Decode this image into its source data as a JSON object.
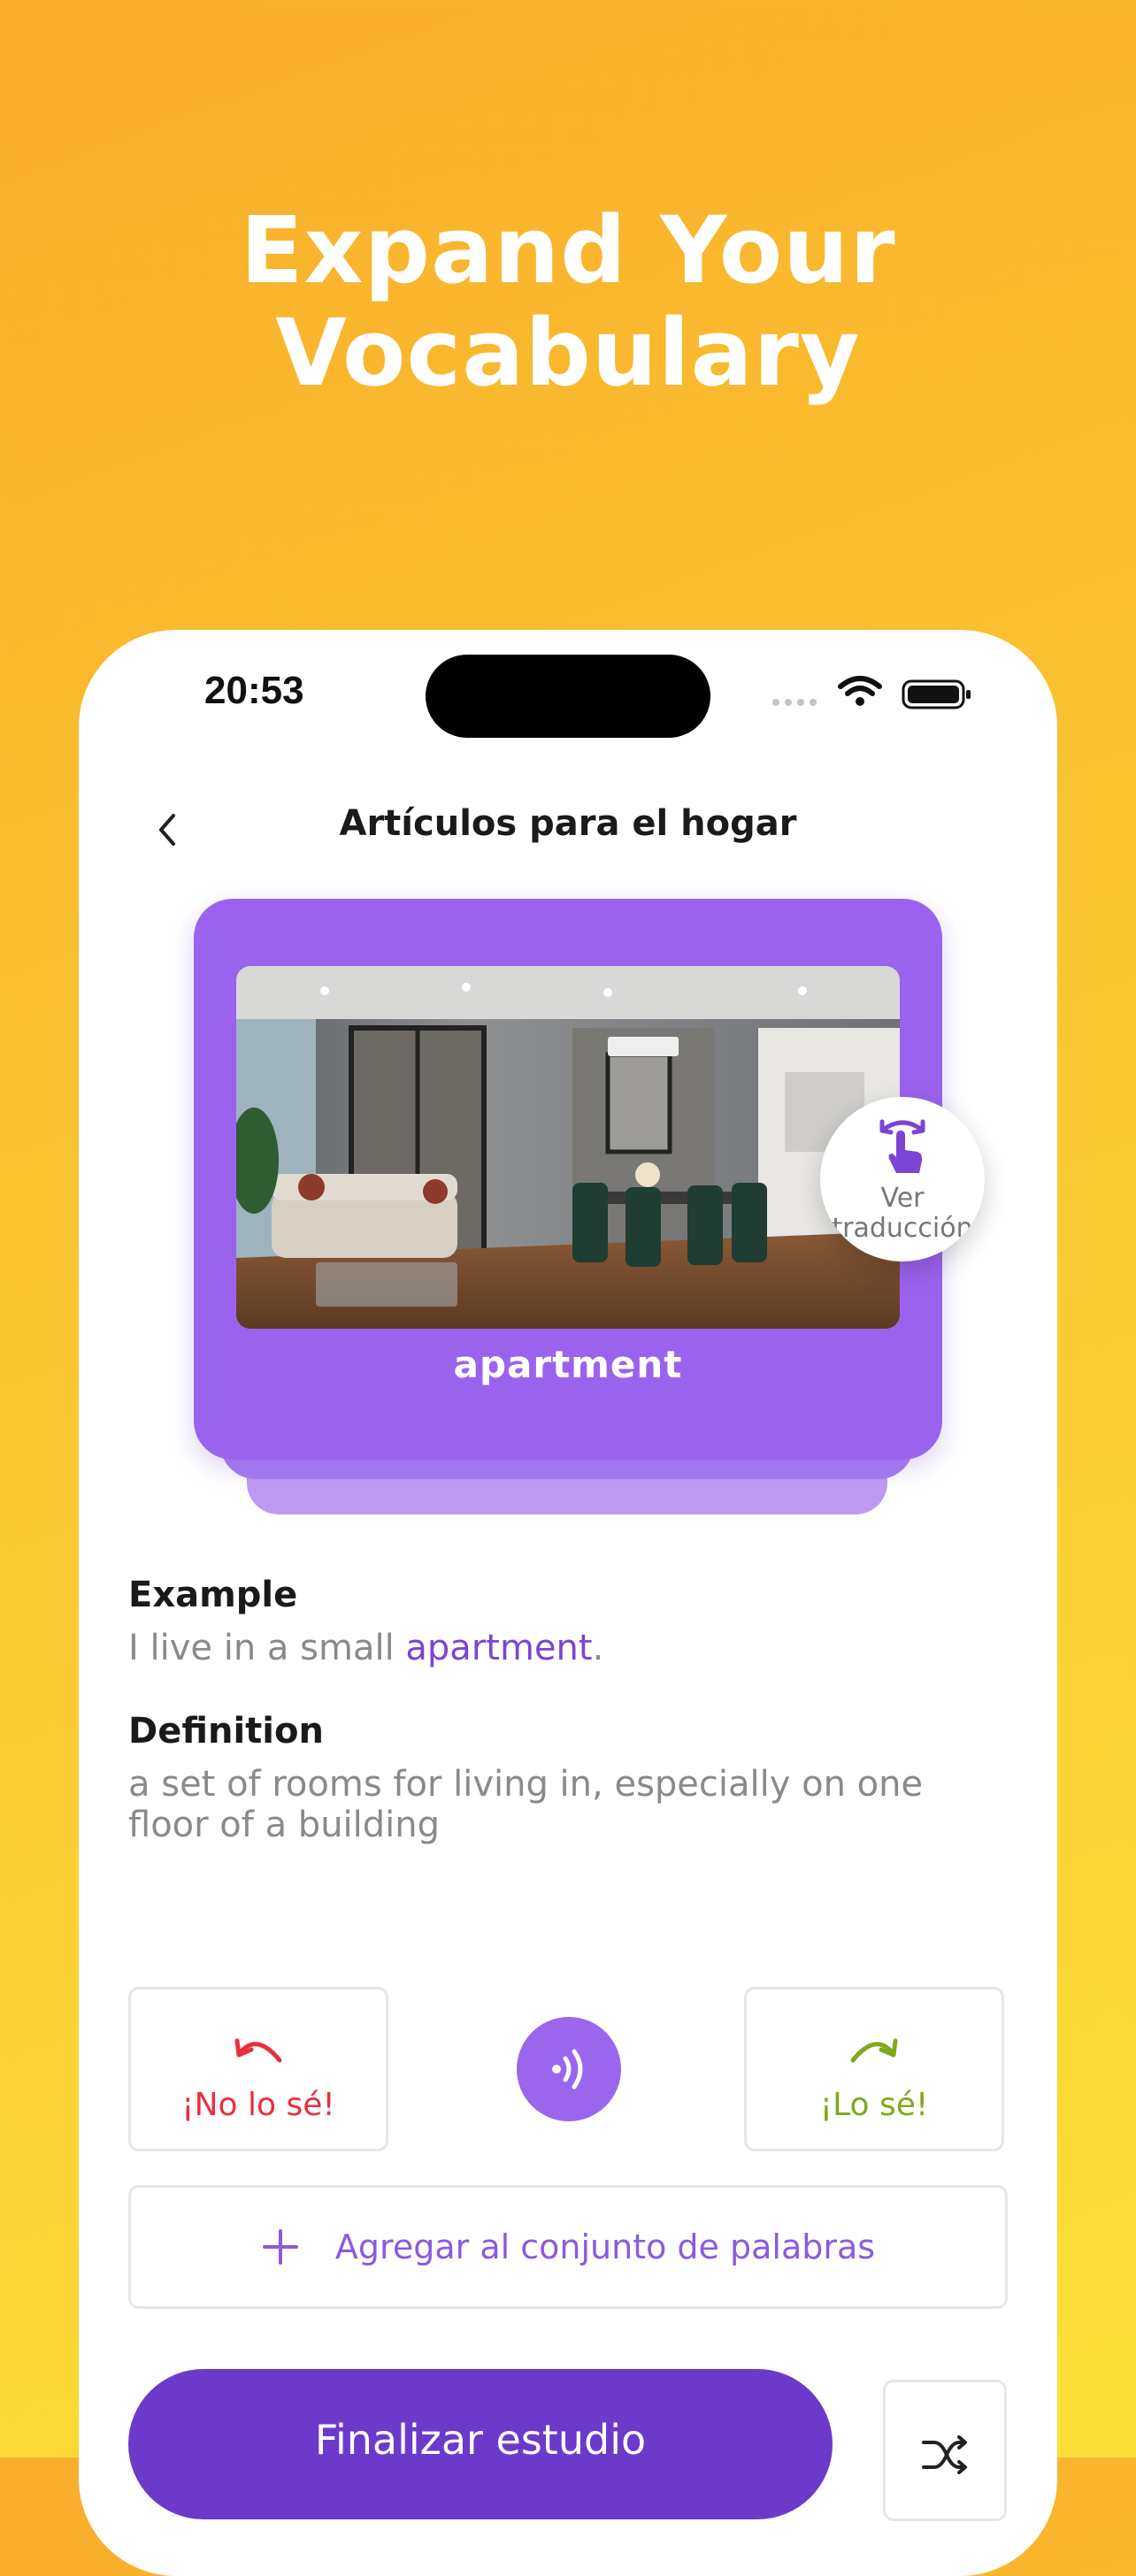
{
  "marketing": {
    "headline_line1": "Expand Your",
    "headline_line2": "Vocabulary"
  },
  "status_bar": {
    "time": "20:53"
  },
  "nav": {
    "title": "Artículos para el hogar",
    "back_icon": "chevron-left-icon"
  },
  "card": {
    "word": "apartment",
    "image_subject": "living room and dining room interior",
    "translate_line1": "Ver",
    "translate_line2": "traducción"
  },
  "example": {
    "label": "Example",
    "text_before": "I live in a small ",
    "highlight": "apartment",
    "text_after": "."
  },
  "definition": {
    "label": "Definition",
    "text": "a set of rooms for living in, especially on one floor of a building"
  },
  "actions": {
    "dont_know": "¡No lo sé!",
    "know": "¡Lo sé!",
    "add_to_set": "Agregar al conjunto de palabras",
    "finish": "Finalizar estudio"
  },
  "colors": {
    "background_gradient": [
      "#F9AE2C",
      "#FBDF36"
    ],
    "accent_purple": "#9B66EE",
    "primary_button": "#6B3ACB",
    "dont_know_red": "#E8303D",
    "know_green": "#7FA91E"
  }
}
